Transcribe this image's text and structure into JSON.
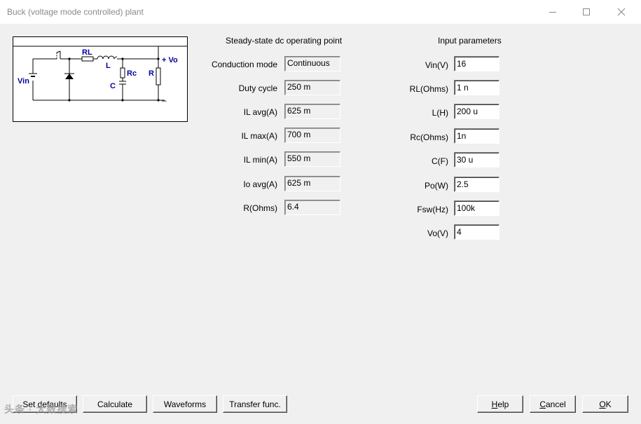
{
  "window": {
    "title": "Buck (voltage mode controlled) plant"
  },
  "schematic": {
    "labels": {
      "vin": "Vin",
      "rl": "RL",
      "l": "L",
      "rc": "Rc",
      "c": "C",
      "r": "R",
      "vo": "+ Vo",
      "minus": "–"
    },
    "label_color": "#0000a0"
  },
  "operating_point": {
    "header": "Steady-state dc operating point",
    "rows": [
      {
        "label": "Conduction mode",
        "value": "Continuous"
      },
      {
        "label": "Duty cycle",
        "value": "250 m"
      },
      {
        "label": "IL avg(A)",
        "value": "625 m"
      },
      {
        "label": "IL max(A)",
        "value": "700 m"
      },
      {
        "label": "IL min(A)",
        "value": "550 m"
      },
      {
        "label": "Io avg(A)",
        "value": "625 m"
      },
      {
        "label": "R(Ohms)",
        "value": "6.4"
      }
    ]
  },
  "input_parameters": {
    "header": "Input parameters",
    "rows": [
      {
        "label": "Vin(V)",
        "value": "16"
      },
      {
        "label": "RL(Ohms)",
        "value": "1 n"
      },
      {
        "label": "L(H)",
        "value": "200 u"
      },
      {
        "label": "Rc(Ohms)",
        "value": "1n"
      },
      {
        "label": "C(F)",
        "value": "30 u"
      },
      {
        "label": "Po(W)",
        "value": "2.5"
      },
      {
        "label": "Fsw(Hz)",
        "value": "100k"
      },
      {
        "label": "Vo(V)",
        "value": "4"
      }
    ]
  },
  "buttons": {
    "set_defaults": "Set defaults",
    "calculate": "Calculate",
    "waveforms": "Waveforms",
    "transfer_func": "Transfer func.",
    "help": {
      "mn": "H",
      "rest": "elp"
    },
    "cancel": {
      "mn": "C",
      "rest": "ancel"
    },
    "ok": {
      "mn": "O",
      "rest": "K"
    }
  },
  "watermark": "头条 · 大数搜索"
}
